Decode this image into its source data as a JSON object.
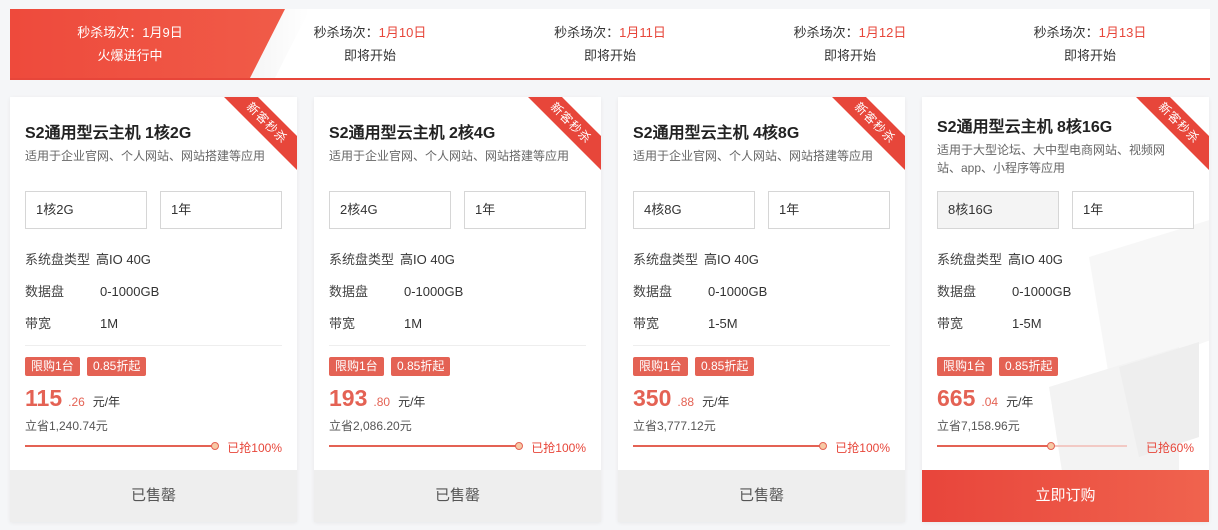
{
  "tabs": [
    {
      "prefix": "秒杀场次：",
      "date": "1月9日",
      "status": "火爆进行中",
      "active": true
    },
    {
      "prefix": "秒杀场次：",
      "date": "1月10日",
      "status": "即将开始",
      "active": false
    },
    {
      "prefix": "秒杀场次：",
      "date": "1月11日",
      "status": "即将开始",
      "active": false
    },
    {
      "prefix": "秒杀场次：",
      "date": "1月12日",
      "status": "即将开始",
      "active": false
    },
    {
      "prefix": "秒杀场次：",
      "date": "1月13日",
      "status": "即将开始",
      "active": false
    }
  ],
  "spec_labels": {
    "disk_type": "系统盘类型",
    "data_disk": "数据盘",
    "bandwidth": "带宽"
  },
  "ribbon": "新客秒杀",
  "tag_limit": "限购1台",
  "tag_discount": "0.85折起",
  "price_unit": "元/年",
  "cards": [
    {
      "title": "S2通用型云主机 1核2G",
      "desc": "适用于企业官网、个人网站、网站搭建等应用",
      "config": "1核2G",
      "term": "1年",
      "disk_type": "高IO 40G",
      "data_disk": "0-1000GB",
      "bandwidth": "1M",
      "price_int": "115",
      "price_dec": ".26",
      "save": "立省1,240.74元",
      "progress": 1.0,
      "grab": "已抢100%",
      "button": "已售罄",
      "available": false
    },
    {
      "title": "S2通用型云主机 2核4G",
      "desc": "适用于企业官网、个人网站、网站搭建等应用",
      "config": "2核4G",
      "term": "1年",
      "disk_type": "高IO 40G",
      "data_disk": "0-1000GB",
      "bandwidth": "1M",
      "price_int": "193",
      "price_dec": ".80",
      "save": "立省2,086.20元",
      "progress": 1.0,
      "grab": "已抢100%",
      "button": "已售罄",
      "available": false
    },
    {
      "title": "S2通用型云主机 4核8G",
      "desc": "适用于企业官网、个人网站、网站搭建等应用",
      "config": "4核8G",
      "term": "1年",
      "disk_type": "高IO 40G",
      "data_disk": "0-1000GB",
      "bandwidth": "1-5M",
      "price_int": "350",
      "price_dec": ".88",
      "save": "立省3,777.12元",
      "progress": 1.0,
      "grab": "已抢100%",
      "button": "已售罄",
      "available": false
    },
    {
      "title": "S2通用型云主机 8核16G",
      "desc": "适用于大型论坛、大中型电商网站、视频网站、app、小程序等应用",
      "config": "8核16G",
      "term": "1年",
      "disk_type": "高IO 40G",
      "data_disk": "0-1000GB",
      "bandwidth": "1-5M",
      "price_int": "665",
      "price_dec": ".04",
      "save": "立省7,158.96元",
      "progress": 0.6,
      "grab": "已抢60%",
      "button": "立即订购",
      "available": true
    }
  ]
}
